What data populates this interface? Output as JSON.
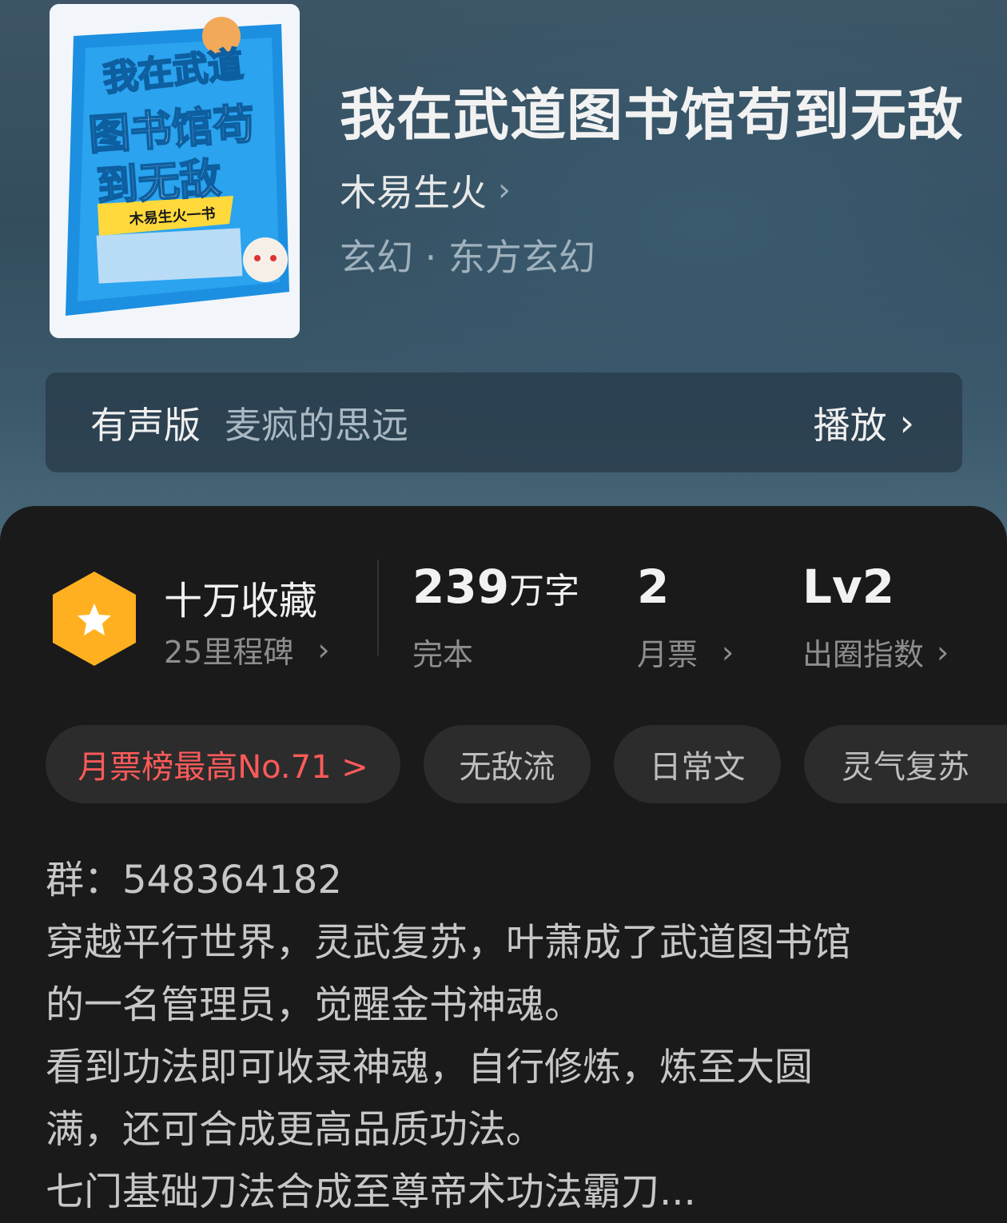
{
  "book": {
    "title": "我在武道图书馆苟到无敌",
    "author": "木易生火",
    "genre": "玄幻 · 东方玄幻",
    "cover_text": [
      "我在武道",
      "图书馆苟",
      "到无敌",
      "木易生火一书"
    ]
  },
  "audio": {
    "label": "有声版",
    "narrator": "麦疯的思远",
    "play_label": "播放"
  },
  "stats": {
    "favorites_title": "十万收藏",
    "milestones": "25里程碑",
    "word_count_number": "239",
    "word_count_unit": "万字",
    "status": "完本",
    "monthly_votes_number": "2",
    "monthly_votes_label": "月票",
    "influence_level": "Lv2",
    "influence_label": "出圈指数"
  },
  "tags": [
    {
      "label": "月票榜最高No.71 >",
      "color": "#ff5a5a"
    },
    {
      "label": "无敌流"
    },
    {
      "label": "日常文"
    },
    {
      "label": "灵气复苏"
    }
  ],
  "description": {
    "lines": [
      "群：548364182",
      "穿越平行世界，灵武复苏，叶萧成了武道图书馆",
      "的一名管理员，觉醒金书神魂。",
      "看到功法即可收录神魂，自行修炼，炼至大圆",
      "满，还可合成更高品质功法。",
      "七门基础刀法合成至尊帝术功法霸刀..."
    ]
  },
  "colors": {
    "accent_hot": "#ff5a5a",
    "badge_orange": "#ffb020"
  }
}
